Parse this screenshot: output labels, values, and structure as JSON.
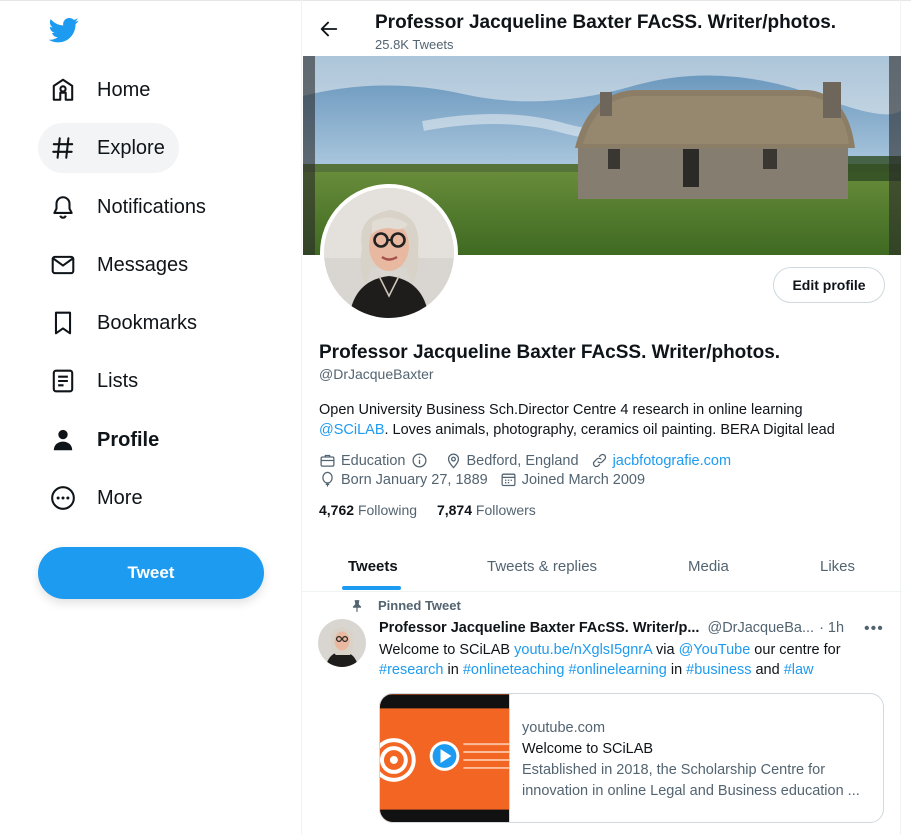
{
  "nav": {
    "items": [
      {
        "label": "Home",
        "icon": "home-icon"
      },
      {
        "label": "Explore",
        "icon": "hashtag-icon"
      },
      {
        "label": "Notifications",
        "icon": "bell-icon"
      },
      {
        "label": "Messages",
        "icon": "envelope-icon"
      },
      {
        "label": "Bookmarks",
        "icon": "bookmark-icon"
      },
      {
        "label": "Lists",
        "icon": "list-icon"
      },
      {
        "label": "Profile",
        "icon": "person-icon"
      },
      {
        "label": "More",
        "icon": "more-circle-icon"
      }
    ],
    "tweet_button": "Tweet"
  },
  "header": {
    "name": "Professor Jacqueline Baxter FAcSS. Writer/photos.",
    "tweet_count": "25.8K Tweets"
  },
  "profile": {
    "edit_button": "Edit profile",
    "name": "Professor Jacqueline Baxter FAcSS. Writer/photos.",
    "handle": "@DrJacqueBaxter",
    "bio_line1": "Open University Business Sch.Director Centre 4 research in online learning",
    "bio_mention": "@SCiLAB",
    "bio_rest": ". Loves animals, photography, ceramics oil painting. BERA Digital lead",
    "category": "Education",
    "location": "Bedford, England",
    "website": "jacbfotografie.com",
    "born": "Born January 27, 1889",
    "joined": "Joined March 2009",
    "following_count": "4,762",
    "following_label": "Following",
    "followers_count": "7,874",
    "followers_label": "Followers"
  },
  "tabs": [
    "Tweets",
    "Tweets & replies",
    "Media",
    "Likes"
  ],
  "pinned_tweet": {
    "pinned_label": "Pinned Tweet",
    "author_name": "Professor Jacqueline Baxter FAcSS. Writer/p...",
    "author_handle": "@DrJacqueBa...",
    "time": "· 1h",
    "text_1": "Welcome to SCiLAB ",
    "link": "youtu.be/nXglsI5gnrA",
    "text_2": " via ",
    "mention": "@YouTube",
    "text_3": " our centre for",
    "hashtag_1": "#research",
    "text_4": " in ",
    "hashtag_2": "#onlineteaching",
    "hashtag_3": "#onlinelearning",
    "text_5": " in ",
    "hashtag_4": "#business",
    "text_6": " and ",
    "hashtag_5": "#law",
    "card": {
      "domain": "youtube.com",
      "title": "Welcome to SCiLAB",
      "description": "Established in 2018, the Scholarship Centre for innovation in online Legal and Business education ..."
    }
  },
  "colors": {
    "accent": "#1d9bf0",
    "text": "#0f1419",
    "muted": "#536471"
  }
}
